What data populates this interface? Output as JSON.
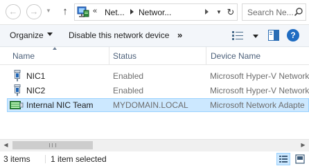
{
  "colors": {
    "selection_bg": "#cce8ff",
    "selection_border": "#99d1ff",
    "header_text": "#4c607a",
    "command_bar_bg": "#f3f6fa",
    "help_blue": "#1f6cc2"
  },
  "navigation": {
    "back_icon": "back-arrow-icon",
    "forward_icon": "forward-arrow-icon",
    "recent_icon": "chevron-down-icon",
    "up_icon": "up-arrow-icon"
  },
  "address": {
    "icon": "network-connections-icon",
    "overflow": "«",
    "crumbs": [
      "Net...",
      "Networ..."
    ],
    "dropdown_icon": "chevron-down-icon",
    "refresh_icon": "refresh-icon"
  },
  "search": {
    "placeholder": "Search Ne...",
    "icon": "search-icon"
  },
  "toolbar": {
    "organize_label": "Organize",
    "disable_label": "Disable this network device",
    "more_label": "»",
    "view_icon": "change-view-icon",
    "pane_icon": "preview-pane-icon",
    "help_label": "?"
  },
  "columns": {
    "name": "Name",
    "status": "Status",
    "device": "Device Name"
  },
  "rows": [
    {
      "name": "NIC1",
      "status": "Enabled",
      "device": "Microsoft Hyper-V Network",
      "icon": "network-adapter-icon",
      "selected": false
    },
    {
      "name": "NIC2",
      "status": "Enabled",
      "device": "Microsoft Hyper-V Network",
      "icon": "network-adapter-icon",
      "selected": false
    },
    {
      "name": "Internal NIC Team",
      "status": "MYDOMAIN.LOCAL",
      "device": "Microsoft Network Adapte",
      "icon": "nic-team-icon",
      "selected": true
    }
  ],
  "scrollbar": {
    "left_icon": "scroll-left-icon",
    "right_icon": "scroll-right-icon"
  },
  "status_bar": {
    "item_count": "3 items",
    "selection": "1 item selected",
    "details_view_icon": "details-view-icon",
    "tiles_view_icon": "large-icons-view-icon"
  }
}
